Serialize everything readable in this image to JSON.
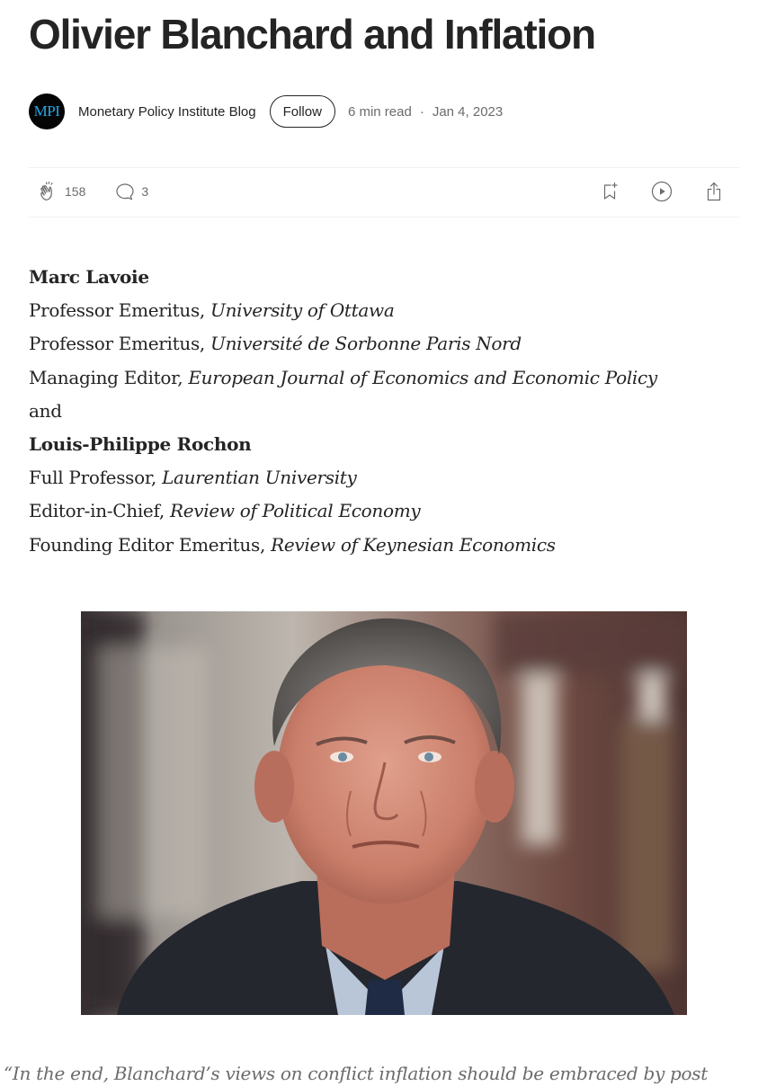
{
  "article": {
    "title": "Olivier Blanchard and Inflation"
  },
  "byline": {
    "avatar_text": "MPI",
    "publication": "Monetary Policy Institute Blog",
    "follow_label": "Follow",
    "read_time": "6 min read",
    "separator": "·",
    "date": "Jan 4, 2023"
  },
  "actions": {
    "claps": "158",
    "responses": "3",
    "icons": [
      "clap-icon",
      "comment-icon",
      "bookmark-add-icon",
      "play-icon",
      "share-icon"
    ]
  },
  "authors": [
    {
      "name": "Marc Lavoie",
      "roles": [
        {
          "title": "Professor Emeritus,",
          "affiliation": "University of Ottawa"
        },
        {
          "title": "Professor Emeritus,",
          "affiliation": "Université de Sorbonne Paris Nord"
        },
        {
          "title": "Managing Editor,",
          "affiliation": "European Journal of Economics and Economic Policy"
        }
      ]
    },
    {
      "name": "Louis-Philippe Rochon",
      "roles": [
        {
          "title": "Full Professor,",
          "affiliation": "Laurentian University"
        },
        {
          "title": "Editor-in-Chief,",
          "affiliation": "Review of Political Economy"
        },
        {
          "title": "Founding Editor Emeritus,",
          "affiliation": "Review of Keynesian Economics"
        }
      ]
    }
  ],
  "authors_joiner": "and",
  "quote": {
    "text": "“In the end, Blanchard’s views on conflict inflation should be embraced by post"
  },
  "colors": {
    "text": "#242424",
    "muted": "#6b6b6b",
    "divider": "#f0f0f0",
    "avatar_bg": "#050505",
    "avatar_text": "#2aa7e6"
  }
}
